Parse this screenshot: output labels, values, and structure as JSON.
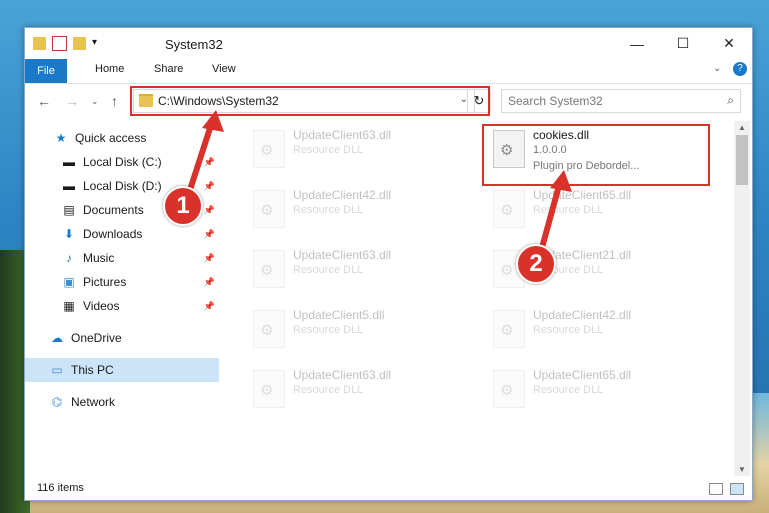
{
  "window": {
    "title": "System32",
    "controls": {
      "minimize": "—",
      "maximize": "☐",
      "close": "✕"
    }
  },
  "ribbon": {
    "file": "File",
    "home": "Home",
    "share": "Share",
    "view": "View"
  },
  "address": {
    "path": "C:\\Windows\\System32",
    "search_placeholder": "Search System32"
  },
  "sidebar": {
    "items": [
      {
        "label": "Quick access",
        "icon": "star-icon"
      },
      {
        "label": "Local Disk (C:)",
        "icon": "drive-icon",
        "pinned": true
      },
      {
        "label": "Local Disk (D:)",
        "icon": "drive-icon",
        "pinned": true
      },
      {
        "label": "Documents",
        "icon": "documents-icon",
        "pinned": true
      },
      {
        "label": "Downloads",
        "icon": "download-icon",
        "pinned": true
      },
      {
        "label": "Music",
        "icon": "music-icon",
        "pinned": true
      },
      {
        "label": "Pictures",
        "icon": "pictures-icon",
        "pinned": true
      },
      {
        "label": "Videos",
        "icon": "videos-icon",
        "pinned": true
      },
      {
        "label": "OneDrive",
        "icon": "cloud-icon"
      },
      {
        "label": "This PC",
        "icon": "computer-icon",
        "selected": true
      },
      {
        "label": "Network",
        "icon": "network-icon"
      }
    ]
  },
  "files": {
    "highlighted": {
      "name": "cookies.dll",
      "version": "1.0.0.0",
      "description": "Plugin pro Debordel..."
    },
    "ghosts": [
      {
        "name": "UpdateClient63.dll",
        "desc": "Resource DLL"
      },
      {
        "name": "UpdateClient42.dll",
        "desc": "Resource DLL"
      },
      {
        "name": "UpdateClient63.dll",
        "desc": "Resource DLL"
      },
      {
        "name": "UpdateClient5.dll",
        "desc": "Resource DLL"
      },
      {
        "name": "UpdateClient63.dll",
        "desc": "Resource DLL"
      },
      {
        "name": "UpdateClient65.dll",
        "desc": "Resource DLL"
      },
      {
        "name": "UpdateClient21.dll",
        "desc": "Resource DLL"
      },
      {
        "name": "UpdateClient42.dll",
        "desc": "Resource DLL"
      },
      {
        "name": "UpdateClient65.dll",
        "desc": "Resource DLL"
      }
    ]
  },
  "status": {
    "count": "116 items"
  },
  "annotations": {
    "marker1": "1",
    "marker2": "2"
  },
  "colors": {
    "accent": "#1979ca",
    "highlight": "#d9322b",
    "selected": "#cce4f7"
  }
}
